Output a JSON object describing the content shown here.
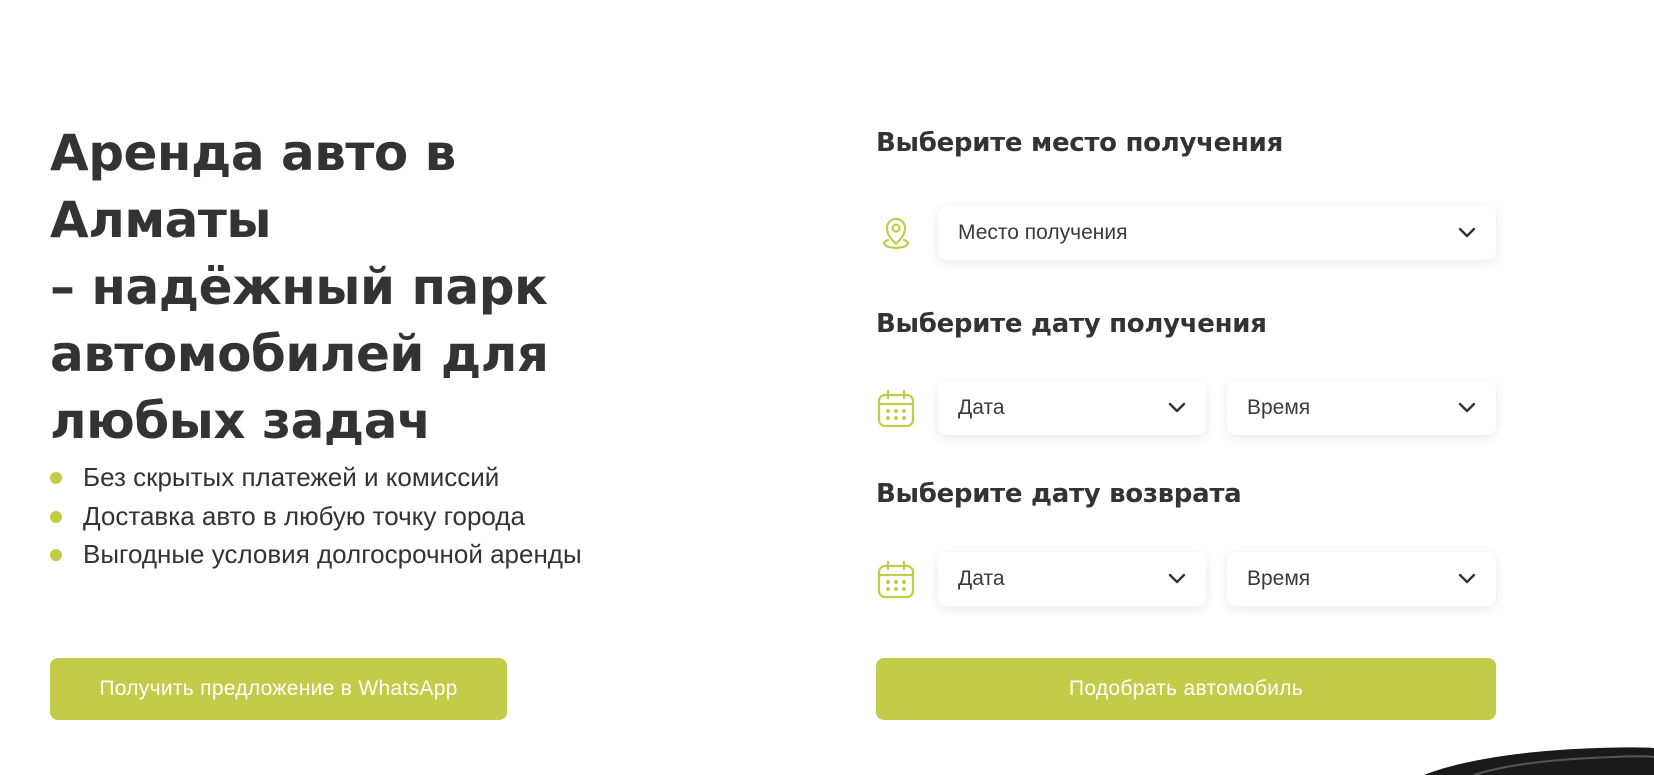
{
  "hero": {
    "title_lines": [
      "Аренда авто в Алматы",
      "– надёжный парк",
      "автомобилей для",
      "любых задач"
    ],
    "benefits": [
      "Без скрытых платежей и комиссий",
      "Доставка авто в любую точку города",
      "Выгодные условия долгосрочной аренды"
    ],
    "whatsapp_button": "Получить предложение в WhatsApp"
  },
  "form": {
    "place_title": "Выберите место получения",
    "place_select": "Место получения",
    "pickup_title": "Выберите дату получения",
    "pickup_date": "Дата",
    "pickup_time": "Время",
    "return_title": "Выберите дату возврата",
    "return_date": "Дата",
    "return_time": "Время",
    "submit_button": "Подобрать автомобиль"
  },
  "icons": {
    "place": "map-pin-icon",
    "calendar": "calendar-icon",
    "chevron": "chevron-down-icon",
    "bullet": "bullet-dot-icon"
  },
  "colors": {
    "accent": "#c3cc48",
    "text": "#333333",
    "background": "#ffffff"
  }
}
